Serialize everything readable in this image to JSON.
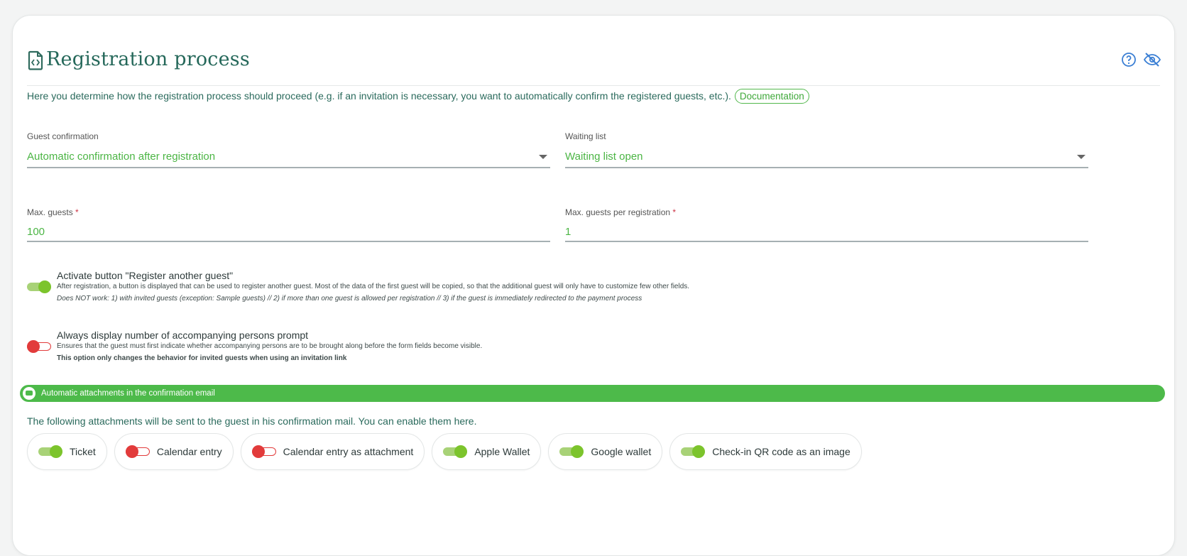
{
  "header": {
    "title": "Registration process",
    "icons": [
      "file-code-icon",
      "help-circle-icon",
      "eye-off-icon"
    ]
  },
  "intro": {
    "text": "Here you determine how the registration process should proceed (e.g. if an invitation is necessary, you want to automatically confirm the registered guests, etc.).",
    "doc_label": "Documentation"
  },
  "fields": {
    "guest_confirmation": {
      "label": "Guest confirmation",
      "value": "Automatic confirmation after registration"
    },
    "waiting_list": {
      "label": "Waiting list",
      "value": "Waiting list open"
    },
    "max_guests": {
      "label": "Max. guests",
      "required": "*",
      "value": "100"
    },
    "max_per_registration": {
      "label": "Max. guests per registration",
      "required": "*",
      "value": "1"
    }
  },
  "options": {
    "register_another": {
      "title": "Activate button \"Register another guest\"",
      "enabled": true,
      "desc1": "After registration, a button is displayed that can be used to register another guest. Most of the data of the first guest will be copied, so that the additional guest will only have to customize few other fields.",
      "desc2": "Does NOT work: 1) with invited guests (exception: Sample guests) // 2) if more than one guest is allowed per registration // 3) if the guest is immediately redirected to the payment process"
    },
    "accompanying": {
      "title": "Always display number of accompanying persons prompt",
      "enabled": false,
      "desc1": "Ensures that the guest must first indicate whether accompanying persons are to be brought along before the form fields become visible.",
      "desc2": "This option only changes the behavior for invited guests when using an invitation link"
    }
  },
  "attachments": {
    "banner": "Automatic attachments in the confirmation email",
    "intro": "The following attachments will be sent to the guest in his confirmation mail. You can enable them here.",
    "items": [
      {
        "label": "Ticket",
        "enabled": true
      },
      {
        "label": "Calendar entry",
        "enabled": false
      },
      {
        "label": "Calendar entry as attachment",
        "enabled": false
      },
      {
        "label": "Apple Wallet",
        "enabled": true
      },
      {
        "label": "Google wallet",
        "enabled": true
      },
      {
        "label": "Check-in QR code as an image",
        "enabled": true
      }
    ]
  },
  "colors": {
    "accent": "#4dba4a",
    "off": "#e23b3b",
    "text": "#2a6a5c"
  }
}
